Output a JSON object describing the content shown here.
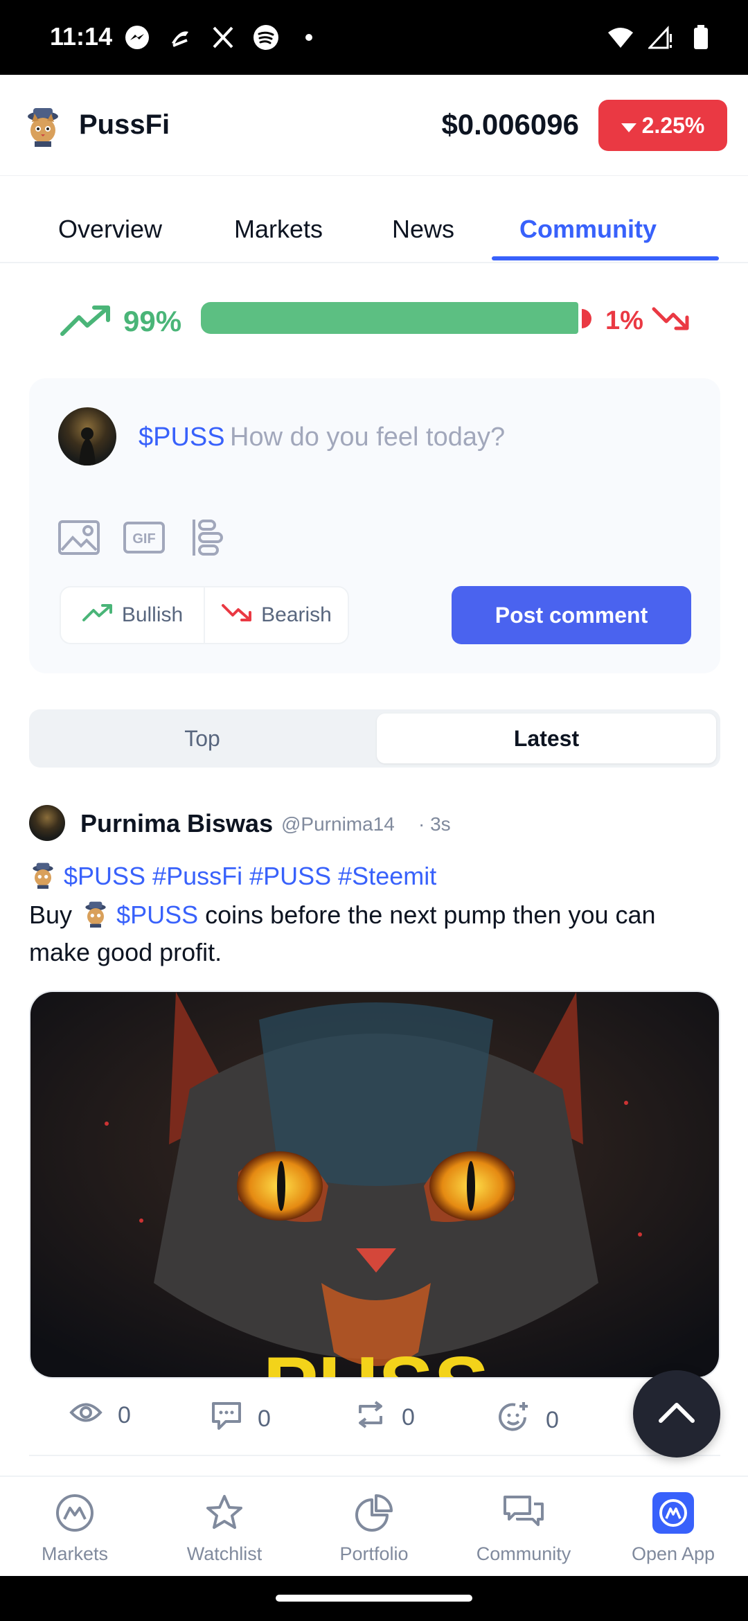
{
  "status_bar": {
    "time": "11:14",
    "left_icons": [
      "messenger-icon",
      "stylus-icon",
      "x-icon",
      "spotify-icon",
      "dot-icon"
    ],
    "right_icons": [
      "wifi-icon",
      "signal-icon",
      "battery-icon"
    ]
  },
  "header": {
    "coin_name": "PussFi",
    "price": "$0.006096",
    "change": "2.25%",
    "change_color": "#ea3943"
  },
  "tabs": [
    {
      "label": "Overview",
      "active": false
    },
    {
      "label": "Markets",
      "active": false
    },
    {
      "label": "News",
      "active": false
    },
    {
      "label": "Community",
      "active": true
    }
  ],
  "sentiment": {
    "bullish_percent": "99%",
    "bearish_percent": "1%",
    "bullish_fraction": 0.99,
    "bull_color": "#5cbf82",
    "bear_color": "#ea3943"
  },
  "composer": {
    "ticker": "$PUSS",
    "placeholder": "How do you feel today?",
    "tools": [
      "image-icon",
      "gif-icon",
      "poll-icon"
    ],
    "bullish_label": "Bullish",
    "bearish_label": "Bearish",
    "post_label": "Post comment"
  },
  "sort": {
    "top_label": "Top",
    "latest_label": "Latest",
    "selected": "Latest"
  },
  "post": {
    "author": "Purnima Biswas",
    "handle": "@Purnima14",
    "time": "· 3s",
    "tags_line": "$PUSS #PussFi #PUSS #Steemit",
    "body_buy": "Buy",
    "body_ticker": "$PUSS",
    "body_rest": "coins before the next pump then you can",
    "body_line2": "make good profit.",
    "image_text": "PUSS",
    "stats": {
      "views": "0",
      "comments": "0",
      "reposts": "0",
      "reactions": "0"
    }
  },
  "bottom_nav": [
    {
      "label": "Markets",
      "icon": "markets-icon"
    },
    {
      "label": "Watchlist",
      "icon": "star-icon"
    },
    {
      "label": "Portfolio",
      "icon": "pie-chart-icon"
    },
    {
      "label": "Community",
      "icon": "chat-icon"
    },
    {
      "label": "Open App",
      "icon": "app-logo-icon"
    }
  ]
}
